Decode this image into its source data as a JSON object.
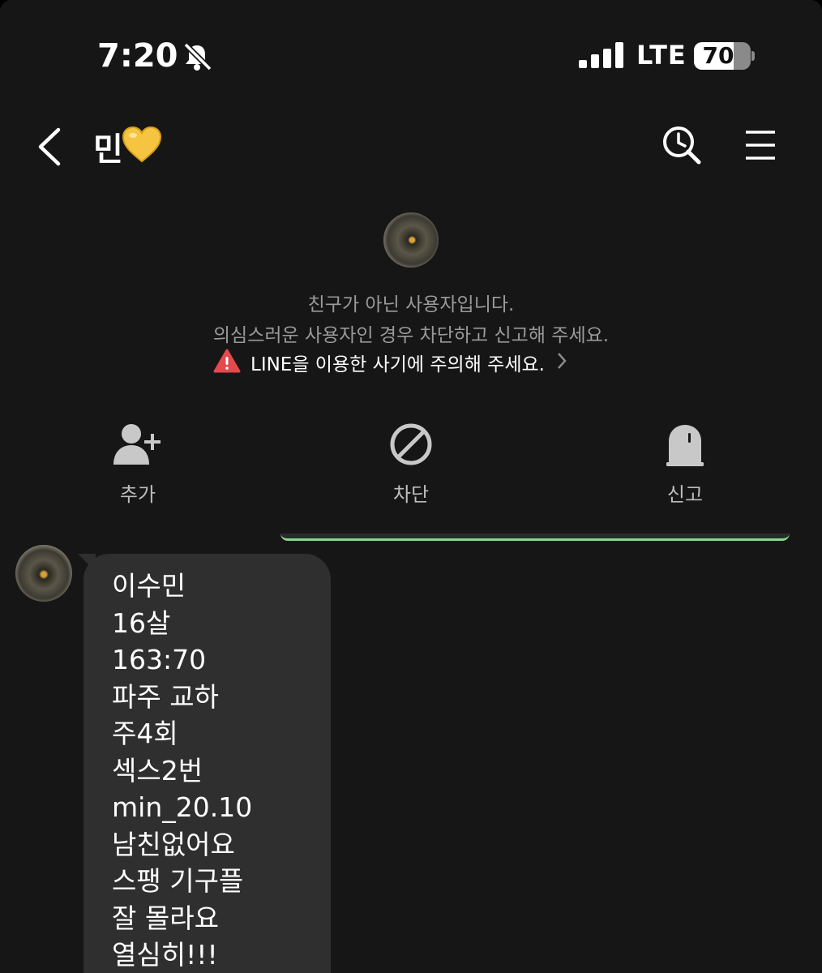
{
  "status_bar": {
    "time": "7:20",
    "network": "LTE",
    "battery": "70",
    "battery_level": 0.7,
    "icons": [
      "bell-slash-icon",
      "signal-icon",
      "battery-icon"
    ]
  },
  "header": {
    "title": "민",
    "title_emoji": "yellow-heart-icon",
    "icons": [
      "back-chevron-icon",
      "search-clock-icon",
      "menu-icon"
    ]
  },
  "profile_notice": {
    "line1": "친구가 아닌 사용자입니다.",
    "line2": "의심스러운 사용자인 경우 차단하고 신고해 주세요.",
    "warning": "LINE을 이용한 사기에 주의해 주세요."
  },
  "actions": [
    {
      "label": "추가",
      "icon": "add-friend-icon"
    },
    {
      "label": "차단",
      "icon": "block-icon"
    },
    {
      "label": "신고",
      "icon": "report-icon"
    }
  ],
  "message": {
    "lines": [
      "이수민",
      "16살",
      "163:70",
      "파주 교하",
      "주4회",
      "섹스2번",
      "min_20.10",
      "남친없어요",
      "스팽 기구플",
      "잘 몰라요",
      "열심히!!!"
    ]
  },
  "colors": {
    "background": "#161616",
    "bubble": "#2f2f2f",
    "warning_red": "#e5484d",
    "accent_green": "#8fd48a",
    "heart_yellow": "#f5c542"
  }
}
